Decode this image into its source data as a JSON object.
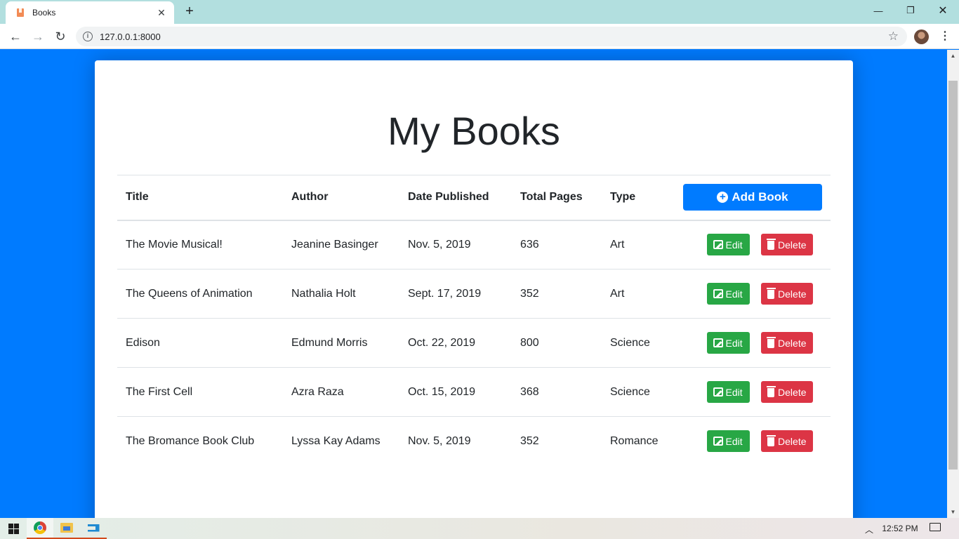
{
  "browser": {
    "tab_title": "Books",
    "tab_close": "✕",
    "new_tab": "+",
    "url": "127.0.0.1:8000",
    "window_controls": {
      "minimize": "—",
      "maximize": "❐",
      "close": "✕"
    },
    "nav": {
      "back": "←",
      "forward": "→",
      "reload": "↻",
      "info": "i",
      "star": "☆",
      "menu": "⋮"
    }
  },
  "page": {
    "title": "My Books",
    "add_button_label": "Add Book",
    "columns": [
      "Title",
      "Author",
      "Date Published",
      "Total Pages",
      "Type"
    ],
    "edit_label": "Edit",
    "delete_label": "Delete",
    "books": [
      {
        "title": "The Movie Musical!",
        "author": "Jeanine Basinger",
        "date": "Nov. 5, 2019",
        "pages": "636",
        "type": "Art"
      },
      {
        "title": "The Queens of Animation",
        "author": "Nathalia Holt",
        "date": "Sept. 17, 2019",
        "pages": "352",
        "type": "Art"
      },
      {
        "title": "Edison",
        "author": "Edmund Morris",
        "date": "Oct. 22, 2019",
        "pages": "800",
        "type": "Science"
      },
      {
        "title": "The First Cell",
        "author": "Azra Raza",
        "date": "Oct. 15, 2019",
        "pages": "368",
        "type": "Science"
      },
      {
        "title": "The Bromance Book Club",
        "author": "Lyssa Kay Adams",
        "date": "Nov. 5, 2019",
        "pages": "352",
        "type": "Romance"
      }
    ]
  },
  "taskbar": {
    "clock": "12:52 PM",
    "tray_chevron": "︿",
    "apps": [
      "chrome-icon",
      "file-explorer-icon",
      "vscode-icon"
    ]
  },
  "colors": {
    "page_background": "#007bff",
    "primary": "#007bff",
    "success": "#28a745",
    "danger": "#dc3545",
    "text": "#212529"
  }
}
